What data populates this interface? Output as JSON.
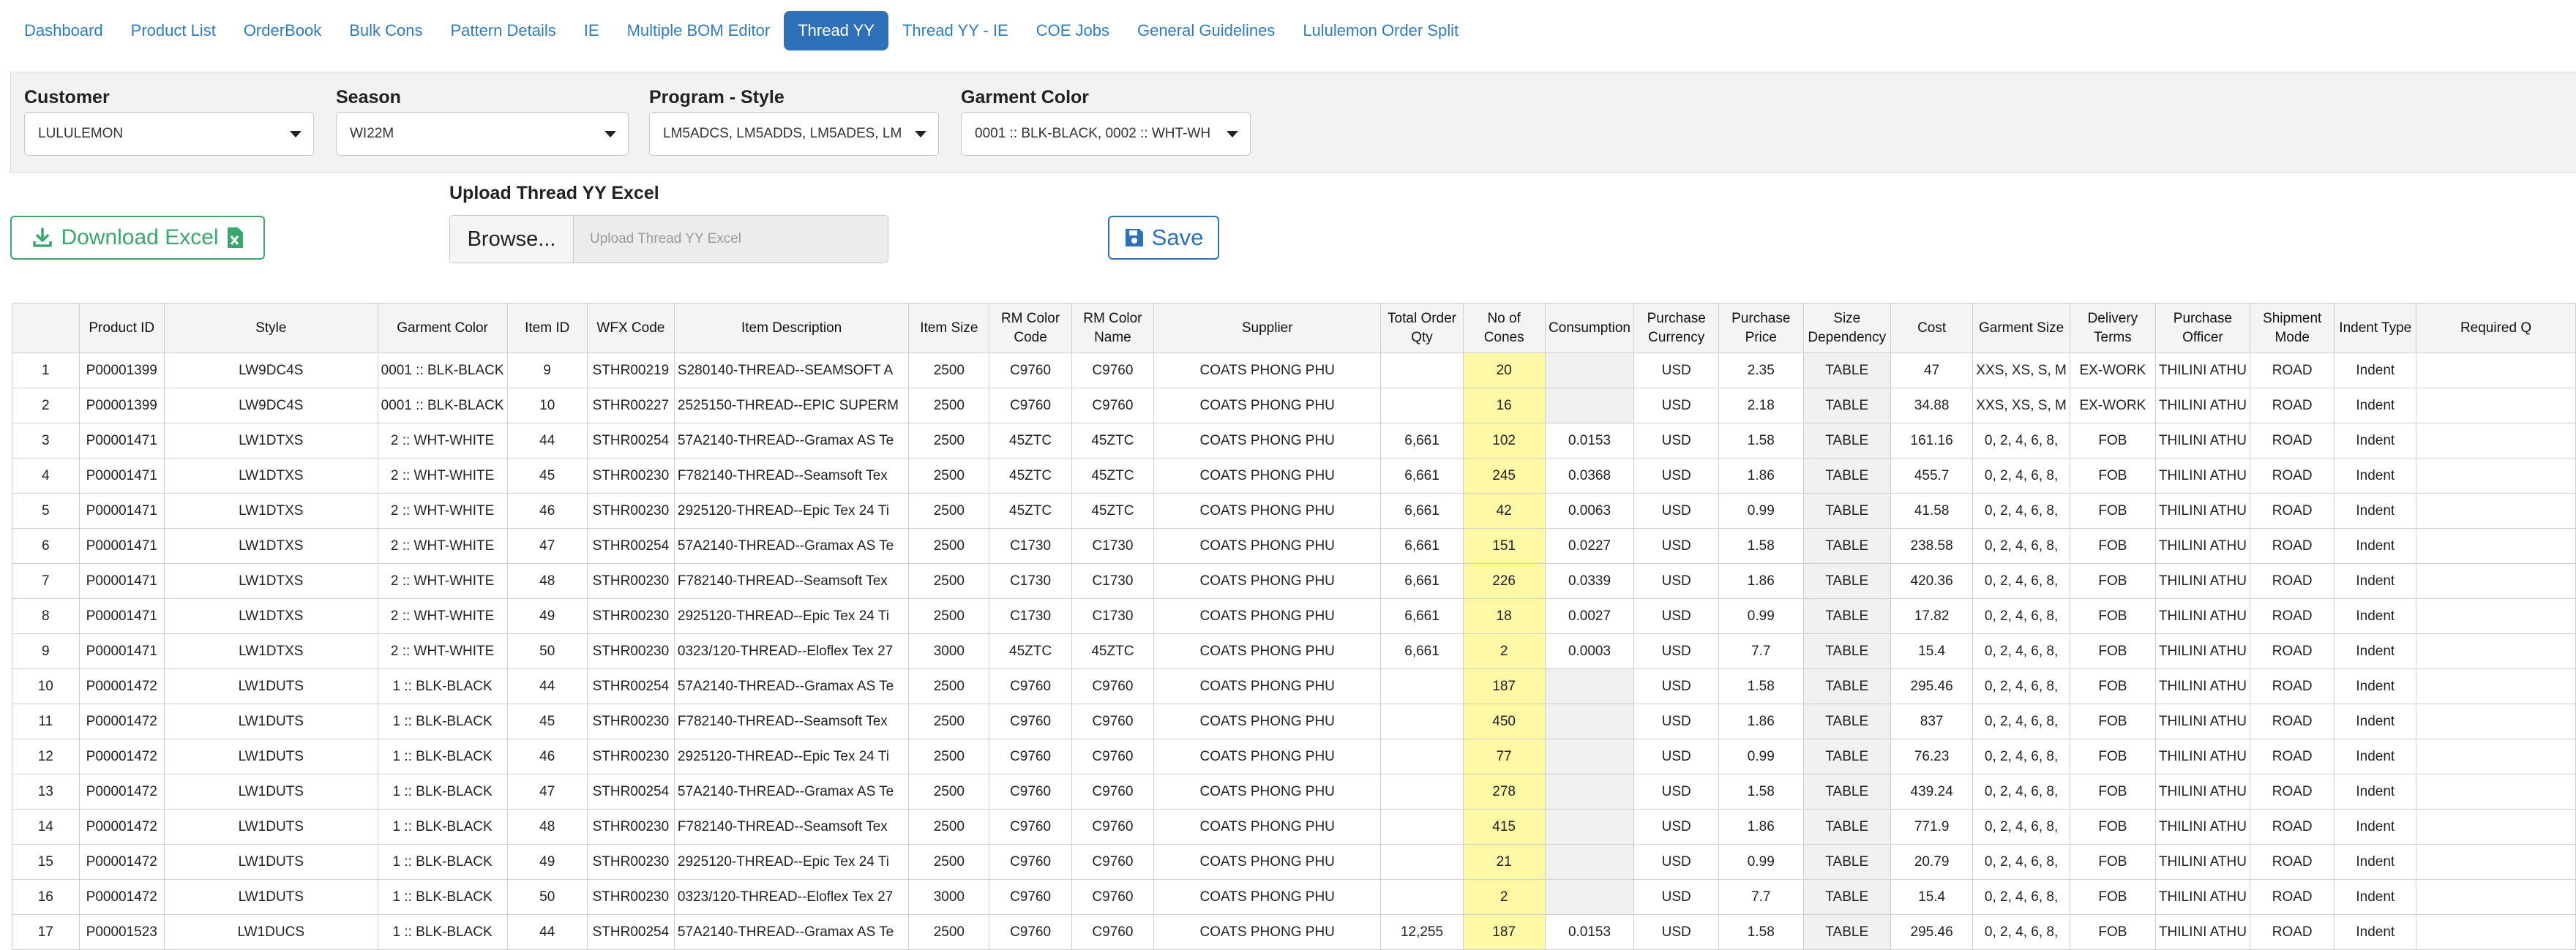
{
  "nav": {
    "tabs": [
      {
        "label": "Dashboard",
        "active": false
      },
      {
        "label": "Product List",
        "active": false
      },
      {
        "label": "OrderBook",
        "active": false
      },
      {
        "label": "Bulk Cons",
        "active": false
      },
      {
        "label": "Pattern Details",
        "active": false
      },
      {
        "label": "IE",
        "active": false
      },
      {
        "label": "Multiple BOM Editor",
        "active": false
      },
      {
        "label": "Thread YY",
        "active": true
      },
      {
        "label": "Thread YY - IE",
        "active": false
      },
      {
        "label": "COE Jobs",
        "active": false
      },
      {
        "label": "General Guidelines",
        "active": false
      },
      {
        "label": "Lululemon Order Split",
        "active": false
      }
    ]
  },
  "filters": {
    "customer": {
      "label": "Customer",
      "value": "LULULEMON"
    },
    "season": {
      "label": "Season",
      "value": "WI22M"
    },
    "program_style": {
      "label": "Program - Style",
      "value": "LM5ADCS, LM5ADDS, LM5ADES, LM"
    },
    "garment_color": {
      "label": "Garment Color",
      "value": "0001 :: BLK-BLACK, 0002 :: WHT-WH"
    }
  },
  "actions": {
    "download_label": "Download Excel",
    "upload_title": "Upload Thread YY Excel",
    "browse_label": "Browse...",
    "upload_placeholder": "Upload Thread YY Excel",
    "save_label": "Save"
  },
  "colors": {
    "accent": "#2f71b8",
    "success": "#3aa76d",
    "cones_highlight": "#fdf8a6"
  },
  "table": {
    "headers": [
      "",
      "Product ID",
      "Style",
      "Garment Color",
      "Item ID",
      "WFX Code",
      "Item Description",
      "Item Size",
      "RM Color Code",
      "RM Color Name",
      "Supplier",
      "Total Order Qty",
      "No of Cones",
      "Consumption",
      "Purchase Currency",
      "Purchase Price",
      "Size Dependency",
      "Cost",
      "Garment Size",
      "Delivery Terms",
      "Purchase Officer",
      "Shipment Mode",
      "Indent Type",
      "Required Q"
    ],
    "rows": [
      [
        "1",
        "P00001399",
        "LW9DC4S",
        "0001 :: BLK-BLACK",
        "9",
        "STHR00219",
        "S280140-THREAD--SEAMSOFT A",
        "2500",
        "C9760",
        "C9760",
        "COATS PHONG PHU",
        "",
        "20",
        "",
        "USD",
        "2.35",
        "TABLE",
        "47",
        "XXS, XS, S, M",
        "EX-WORK",
        "THILINI ATHU",
        "ROAD",
        "Indent",
        ""
      ],
      [
        "2",
        "P00001399",
        "LW9DC4S",
        "0001 :: BLK-BLACK",
        "10",
        "STHR00227",
        "2525150-THREAD--EPIC SUPERM",
        "2500",
        "C9760",
        "C9760",
        "COATS PHONG PHU",
        "",
        "16",
        "",
        "USD",
        "2.18",
        "TABLE",
        "34.88",
        "XXS, XS, S, M",
        "EX-WORK",
        "THILINI ATHU",
        "ROAD",
        "Indent",
        ""
      ],
      [
        "3",
        "P00001471",
        "LW1DTXS",
        "2 :: WHT-WHITE",
        "44",
        "STHR00254",
        "57A2140-THREAD--Gramax AS Te",
        "2500",
        "45ZTC",
        "45ZTC",
        "COATS PHONG PHU",
        "6,661",
        "102",
        "0.0153",
        "USD",
        "1.58",
        "TABLE",
        "161.16",
        "0, 2, 4, 6, 8,",
        "FOB",
        "THILINI ATHU",
        "ROAD",
        "Indent",
        ""
      ],
      [
        "4",
        "P00001471",
        "LW1DTXS",
        "2 :: WHT-WHITE",
        "45",
        "STHR00230",
        "F782140-THREAD--Seamsoft Tex",
        "2500",
        "45ZTC",
        "45ZTC",
        "COATS PHONG PHU",
        "6,661",
        "245",
        "0.0368",
        "USD",
        "1.86",
        "TABLE",
        "455.7",
        "0, 2, 4, 6, 8,",
        "FOB",
        "THILINI ATHU",
        "ROAD",
        "Indent",
        ""
      ],
      [
        "5",
        "P00001471",
        "LW1DTXS",
        "2 :: WHT-WHITE",
        "46",
        "STHR00230",
        "2925120-THREAD--Epic Tex 24 Ti",
        "2500",
        "45ZTC",
        "45ZTC",
        "COATS PHONG PHU",
        "6,661",
        "42",
        "0.0063",
        "USD",
        "0.99",
        "TABLE",
        "41.58",
        "0, 2, 4, 6, 8,",
        "FOB",
        "THILINI ATHU",
        "ROAD",
        "Indent",
        ""
      ],
      [
        "6",
        "P00001471",
        "LW1DTXS",
        "2 :: WHT-WHITE",
        "47",
        "STHR00254",
        "57A2140-THREAD--Gramax AS Te",
        "2500",
        "C1730",
        "C1730",
        "COATS PHONG PHU",
        "6,661",
        "151",
        "0.0227",
        "USD",
        "1.58",
        "TABLE",
        "238.58",
        "0, 2, 4, 6, 8,",
        "FOB",
        "THILINI ATHU",
        "ROAD",
        "Indent",
        ""
      ],
      [
        "7",
        "P00001471",
        "LW1DTXS",
        "2 :: WHT-WHITE",
        "48",
        "STHR00230",
        "F782140-THREAD--Seamsoft Tex",
        "2500",
        "C1730",
        "C1730",
        "COATS PHONG PHU",
        "6,661",
        "226",
        "0.0339",
        "USD",
        "1.86",
        "TABLE",
        "420.36",
        "0, 2, 4, 6, 8,",
        "FOB",
        "THILINI ATHU",
        "ROAD",
        "Indent",
        ""
      ],
      [
        "8",
        "P00001471",
        "LW1DTXS",
        "2 :: WHT-WHITE",
        "49",
        "STHR00230",
        "2925120-THREAD--Epic Tex 24 Ti",
        "2500",
        "C1730",
        "C1730",
        "COATS PHONG PHU",
        "6,661",
        "18",
        "0.0027",
        "USD",
        "0.99",
        "TABLE",
        "17.82",
        "0, 2, 4, 6, 8,",
        "FOB",
        "THILINI ATHU",
        "ROAD",
        "Indent",
        ""
      ],
      [
        "9",
        "P00001471",
        "LW1DTXS",
        "2 :: WHT-WHITE",
        "50",
        "STHR00230",
        "0323/120-THREAD--Eloflex Tex 27",
        "3000",
        "45ZTC",
        "45ZTC",
        "COATS PHONG PHU",
        "6,661",
        "2",
        "0.0003",
        "USD",
        "7.7",
        "TABLE",
        "15.4",
        "0, 2, 4, 6, 8,",
        "FOB",
        "THILINI ATHU",
        "ROAD",
        "Indent",
        ""
      ],
      [
        "10",
        "P00001472",
        "LW1DUTS",
        "1 :: BLK-BLACK",
        "44",
        "STHR00254",
        "57A2140-THREAD--Gramax AS Te",
        "2500",
        "C9760",
        "C9760",
        "COATS PHONG PHU",
        "",
        "187",
        "",
        "USD",
        "1.58",
        "TABLE",
        "295.46",
        "0, 2, 4, 6, 8,",
        "FOB",
        "THILINI ATHU",
        "ROAD",
        "Indent",
        ""
      ],
      [
        "11",
        "P00001472",
        "LW1DUTS",
        "1 :: BLK-BLACK",
        "45",
        "STHR00230",
        "F782140-THREAD--Seamsoft Tex",
        "2500",
        "C9760",
        "C9760",
        "COATS PHONG PHU",
        "",
        "450",
        "",
        "USD",
        "1.86",
        "TABLE",
        "837",
        "0, 2, 4, 6, 8,",
        "FOB",
        "THILINI ATHU",
        "ROAD",
        "Indent",
        ""
      ],
      [
        "12",
        "P00001472",
        "LW1DUTS",
        "1 :: BLK-BLACK",
        "46",
        "STHR00230",
        "2925120-THREAD--Epic Tex 24 Ti",
        "2500",
        "C9760",
        "C9760",
        "COATS PHONG PHU",
        "",
        "77",
        "",
        "USD",
        "0.99",
        "TABLE",
        "76.23",
        "0, 2, 4, 6, 8,",
        "FOB",
        "THILINI ATHU",
        "ROAD",
        "Indent",
        ""
      ],
      [
        "13",
        "P00001472",
        "LW1DUTS",
        "1 :: BLK-BLACK",
        "47",
        "STHR00254",
        "57A2140-THREAD--Gramax AS Te",
        "2500",
        "C9760",
        "C9760",
        "COATS PHONG PHU",
        "",
        "278",
        "",
        "USD",
        "1.58",
        "TABLE",
        "439.24",
        "0, 2, 4, 6, 8,",
        "FOB",
        "THILINI ATHU",
        "ROAD",
        "Indent",
        ""
      ],
      [
        "14",
        "P00001472",
        "LW1DUTS",
        "1 :: BLK-BLACK",
        "48",
        "STHR00230",
        "F782140-THREAD--Seamsoft Tex",
        "2500",
        "C9760",
        "C9760",
        "COATS PHONG PHU",
        "",
        "415",
        "",
        "USD",
        "1.86",
        "TABLE",
        "771.9",
        "0, 2, 4, 6, 8,",
        "FOB",
        "THILINI ATHU",
        "ROAD",
        "Indent",
        ""
      ],
      [
        "15",
        "P00001472",
        "LW1DUTS",
        "1 :: BLK-BLACK",
        "49",
        "STHR00230",
        "2925120-THREAD--Epic Tex 24 Ti",
        "2500",
        "C9760",
        "C9760",
        "COATS PHONG PHU",
        "",
        "21",
        "",
        "USD",
        "0.99",
        "TABLE",
        "20.79",
        "0, 2, 4, 6, 8,",
        "FOB",
        "THILINI ATHU",
        "ROAD",
        "Indent",
        ""
      ],
      [
        "16",
        "P00001472",
        "LW1DUTS",
        "1 :: BLK-BLACK",
        "50",
        "STHR00230",
        "0323/120-THREAD--Eloflex Tex 27",
        "3000",
        "C9760",
        "C9760",
        "COATS PHONG PHU",
        "",
        "2",
        "",
        "USD",
        "7.7",
        "TABLE",
        "15.4",
        "0, 2, 4, 6, 8,",
        "FOB",
        "THILINI ATHU",
        "ROAD",
        "Indent",
        ""
      ],
      [
        "17",
        "P00001523",
        "LW1DUCS",
        "1 :: BLK-BLACK",
        "44",
        "STHR00254",
        "57A2140-THREAD--Gramax AS Te",
        "2500",
        "C9760",
        "C9760",
        "COATS PHONG PHU",
        "12,255",
        "187",
        "0.0153",
        "USD",
        "1.58",
        "TABLE",
        "295.46",
        "0, 2, 4, 6, 8,",
        "FOB",
        "THILINI ATHU",
        "ROAD",
        "Indent",
        ""
      ]
    ]
  }
}
